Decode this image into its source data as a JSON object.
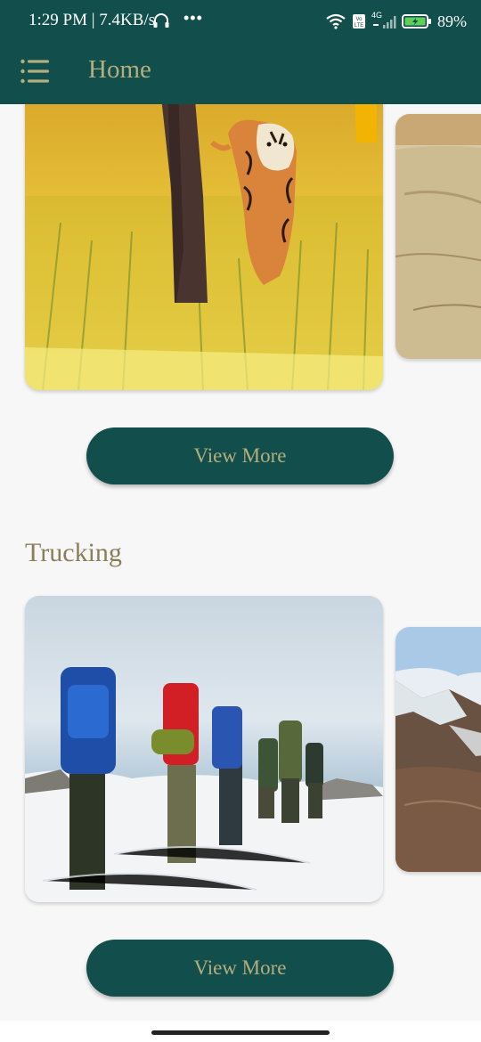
{
  "status_bar": {
    "time": "1:29 PM | 7.4KB/s",
    "more": "•••",
    "network": "4G",
    "battery_percent": "89%",
    "icons": [
      "headphones-icon",
      "wifi-icon",
      "volte-icon",
      "signal-icon",
      "battery-charging-icon"
    ]
  },
  "app_bar": {
    "title": "Home",
    "menu_icon": "menu-list-icon"
  },
  "sections": [
    {
      "title": "",
      "cards": [
        {
          "image": "tiger-in-grass-photo"
        },
        {
          "image": "dirt-road-photo"
        }
      ],
      "button_label": "View More"
    },
    {
      "title": "Trucking",
      "cards": [
        {
          "image": "backpackers-on-snow-photo"
        },
        {
          "image": "snowy-mountains-photo"
        }
      ],
      "button_label": "View More"
    }
  ],
  "colors": {
    "primary": "#124f4c",
    "accent_text": "#b4ad7e",
    "section_title": "#8a7d5a",
    "background": "#f7f7f7"
  }
}
